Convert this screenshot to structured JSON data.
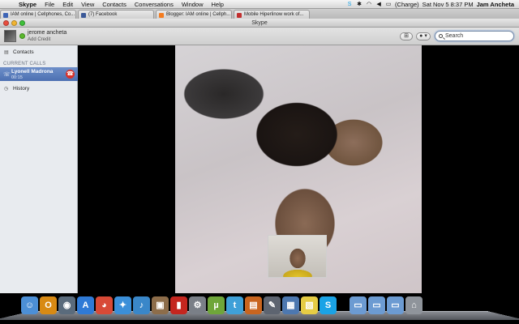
{
  "menubar": {
    "apple": "",
    "items": [
      "Skype",
      "File",
      "Edit",
      "View",
      "Contacts",
      "Conversations",
      "Window",
      "Help"
    ],
    "battery": "(Charge)",
    "clock": "Sat Nov 5  8:37 PM",
    "user": "Jam Ancheta"
  },
  "browser_tabs": [
    {
      "label": "IAM online | Cellphones, Co...",
      "color": "#3d64b5"
    },
    {
      "label": "(7) Facebook",
      "color": "#3b5998"
    },
    {
      "label": "Blogger: IAM online | Cellph...",
      "color": "#f47c20"
    },
    {
      "label": "Mobile Hiperlinow work of...",
      "color": "#c22f2f"
    }
  ],
  "window": {
    "title": "Skype"
  },
  "profile": {
    "name": "jerome ancheta",
    "sub": "Add Credit"
  },
  "toolbar": {
    "view_toggle": "⊞",
    "status_menu": "● ▾",
    "search_placeholder": "Search"
  },
  "sidebar": {
    "contacts": "Contacts",
    "section": "CURRENT CALLS",
    "call": {
      "name": "Lyonell Madrona",
      "time": "00:15"
    },
    "history": "History"
  },
  "dock_icons": [
    {
      "name": "finder",
      "glyph": "☺",
      "color": "#4c8fd6"
    },
    {
      "name": "opera",
      "glyph": "O",
      "color": "#d88a14"
    },
    {
      "name": "screenshot",
      "glyph": "◉",
      "color": "#5a6b7c"
    },
    {
      "name": "app-store",
      "glyph": "A",
      "color": "#2f7ad6"
    },
    {
      "name": "chrome",
      "glyph": "◕",
      "color": "#d84a37"
    },
    {
      "name": "safari",
      "glyph": "✦",
      "color": "#3b8fd9"
    },
    {
      "name": "itunes",
      "glyph": "♪",
      "color": "#3a87c9"
    },
    {
      "name": "iphoto",
      "glyph": "▣",
      "color": "#8d6d4a"
    },
    {
      "name": "photo-booth",
      "glyph": "▮",
      "color": "#c4261f"
    },
    {
      "name": "system-prefs",
      "glyph": "⚙",
      "color": "#7a7f87"
    },
    {
      "name": "utorrent",
      "glyph": "µ",
      "color": "#6fa63a"
    },
    {
      "name": "twitter",
      "glyph": "t",
      "color": "#3fa0d8"
    },
    {
      "name": "keynote",
      "glyph": "▤",
      "color": "#c9651f"
    },
    {
      "name": "instruments",
      "glyph": "✎",
      "color": "#5d6470"
    },
    {
      "name": "preview",
      "glyph": "▦",
      "color": "#4d78b0"
    },
    {
      "name": "stickies",
      "glyph": "▧",
      "color": "#e6cc44"
    },
    {
      "name": "skype",
      "glyph": "S",
      "color": "#1aa3e6"
    },
    {
      "name": "applications",
      "glyph": "▭",
      "color": "#6c9bd2"
    },
    {
      "name": "documents",
      "glyph": "▭",
      "color": "#6c9bd2"
    },
    {
      "name": "downloads",
      "glyph": "▭",
      "color": "#6c9bd2"
    },
    {
      "name": "trash",
      "glyph": "⌂",
      "color": "#8f949b"
    }
  ]
}
